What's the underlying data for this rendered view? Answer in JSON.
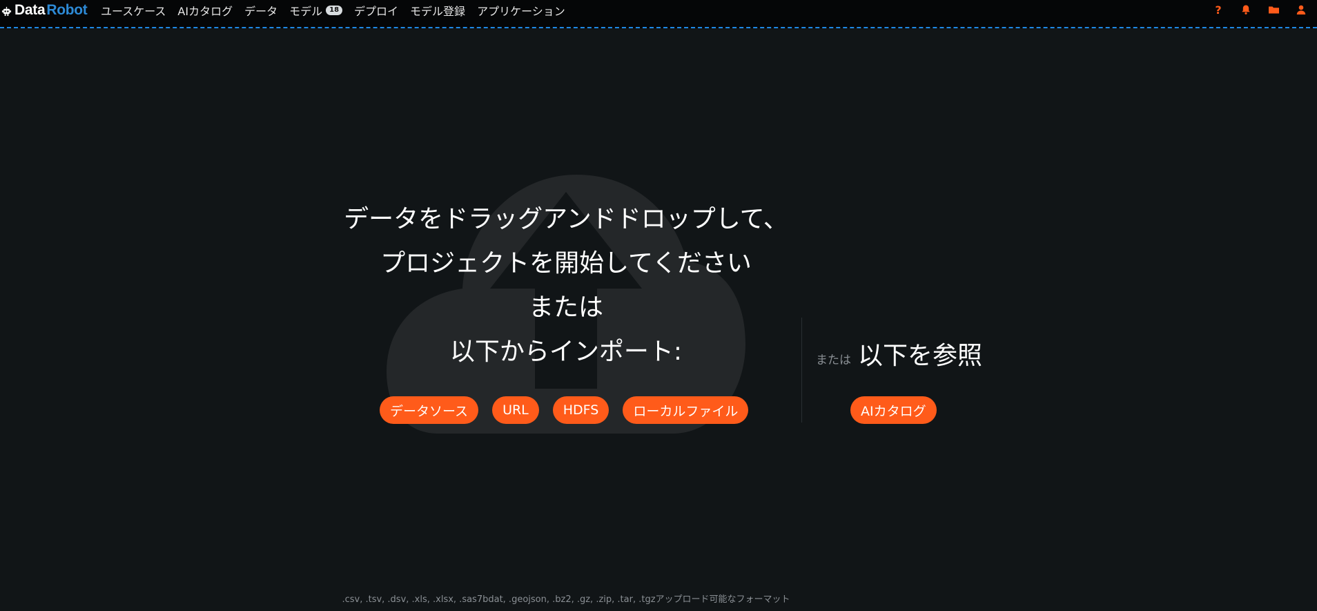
{
  "header": {
    "logo_part1": "Data",
    "logo_part2": "Robot",
    "nav": [
      {
        "label": "ユースケース"
      },
      {
        "label": "AIカタログ"
      },
      {
        "label": "データ"
      },
      {
        "label": "モデル",
        "badge": "18"
      },
      {
        "label": "デプロイ"
      },
      {
        "label": "モデル登録"
      },
      {
        "label": "アプリケーション"
      }
    ],
    "icons": [
      "help-icon",
      "bell-icon",
      "folder-icon",
      "user-icon"
    ],
    "accent_color": "#ff5b1a",
    "divider_color": "#1e88e5"
  },
  "upload": {
    "title_line1": "データをドラッグアンドドロップして、",
    "title_line2": "プロジェクトを開始してください",
    "title_line3": "または",
    "title_line4": "以下からインポート:",
    "buttons": {
      "data_source": "データソース",
      "url": "URL",
      "hdfs": "HDFS",
      "local_file": "ローカルファイル"
    }
  },
  "browse": {
    "or_label": "または",
    "title": "以下を参照",
    "catalog_button": "AIカタログ"
  },
  "footer": {
    "formats": ".csv, .tsv, .dsv, .xls, .xlsx, .sas7bdat, .geojson, .bz2, .gz, .zip, .tar, .tgzアップロード可能なフォーマット"
  }
}
